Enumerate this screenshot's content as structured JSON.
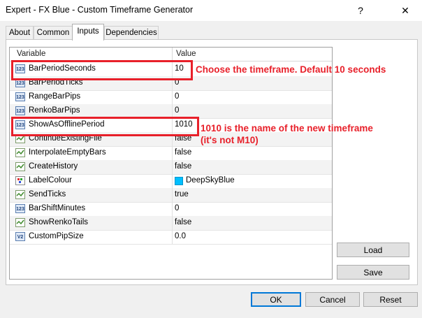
{
  "window": {
    "title": "Expert - FX Blue - Custom Timeframe Generator",
    "help_glyph": "?",
    "close_glyph": "✕"
  },
  "tabs": [
    {
      "label": "About"
    },
    {
      "label": "Common"
    },
    {
      "label": "Inputs"
    },
    {
      "label": "Dependencies"
    }
  ],
  "grid": {
    "col_variable": "Variable",
    "col_value": "Value",
    "rows": [
      {
        "icon": "123",
        "name": "BarPeriodSeconds",
        "value": "10"
      },
      {
        "icon": "123",
        "name": "BarPeriodTicks",
        "value": "0"
      },
      {
        "icon": "123",
        "name": "RangeBarPips",
        "value": "0"
      },
      {
        "icon": "123",
        "name": "RenkoBarPips",
        "value": "0"
      },
      {
        "icon": "123",
        "name": "ShowAsOfflinePeriod",
        "value": "1010"
      },
      {
        "icon": "bool",
        "name": "ContinueExistingFile",
        "value": "false"
      },
      {
        "icon": "bool",
        "name": "InterpolateEmptyBars",
        "value": "false"
      },
      {
        "icon": "bool",
        "name": "CreateHistory",
        "value": "false"
      },
      {
        "icon": "color",
        "name": "LabelColour",
        "value": "DeepSkyBlue"
      },
      {
        "icon": "bool",
        "name": "SendTicks",
        "value": "true"
      },
      {
        "icon": "123",
        "name": "BarShiftMinutes",
        "value": "0"
      },
      {
        "icon": "bool",
        "name": "ShowRenkoTails",
        "value": "false"
      },
      {
        "icon": "v2",
        "name": "CustomPipSize",
        "value": "0.0"
      }
    ]
  },
  "annotations": {
    "first": "Choose the timeframe. Default 10 seconds",
    "second_line1": "1010 is the name of the new timeframe",
    "second_line2": "(it's not M10)"
  },
  "side_buttons": {
    "load": "Load",
    "save": "Save"
  },
  "footer_buttons": {
    "ok": "OK",
    "cancel": "Cancel",
    "reset": "Reset"
  },
  "colors": {
    "accent": "#0078d7",
    "annotation_red": "#e8202a",
    "swatch": "#00bfff"
  }
}
